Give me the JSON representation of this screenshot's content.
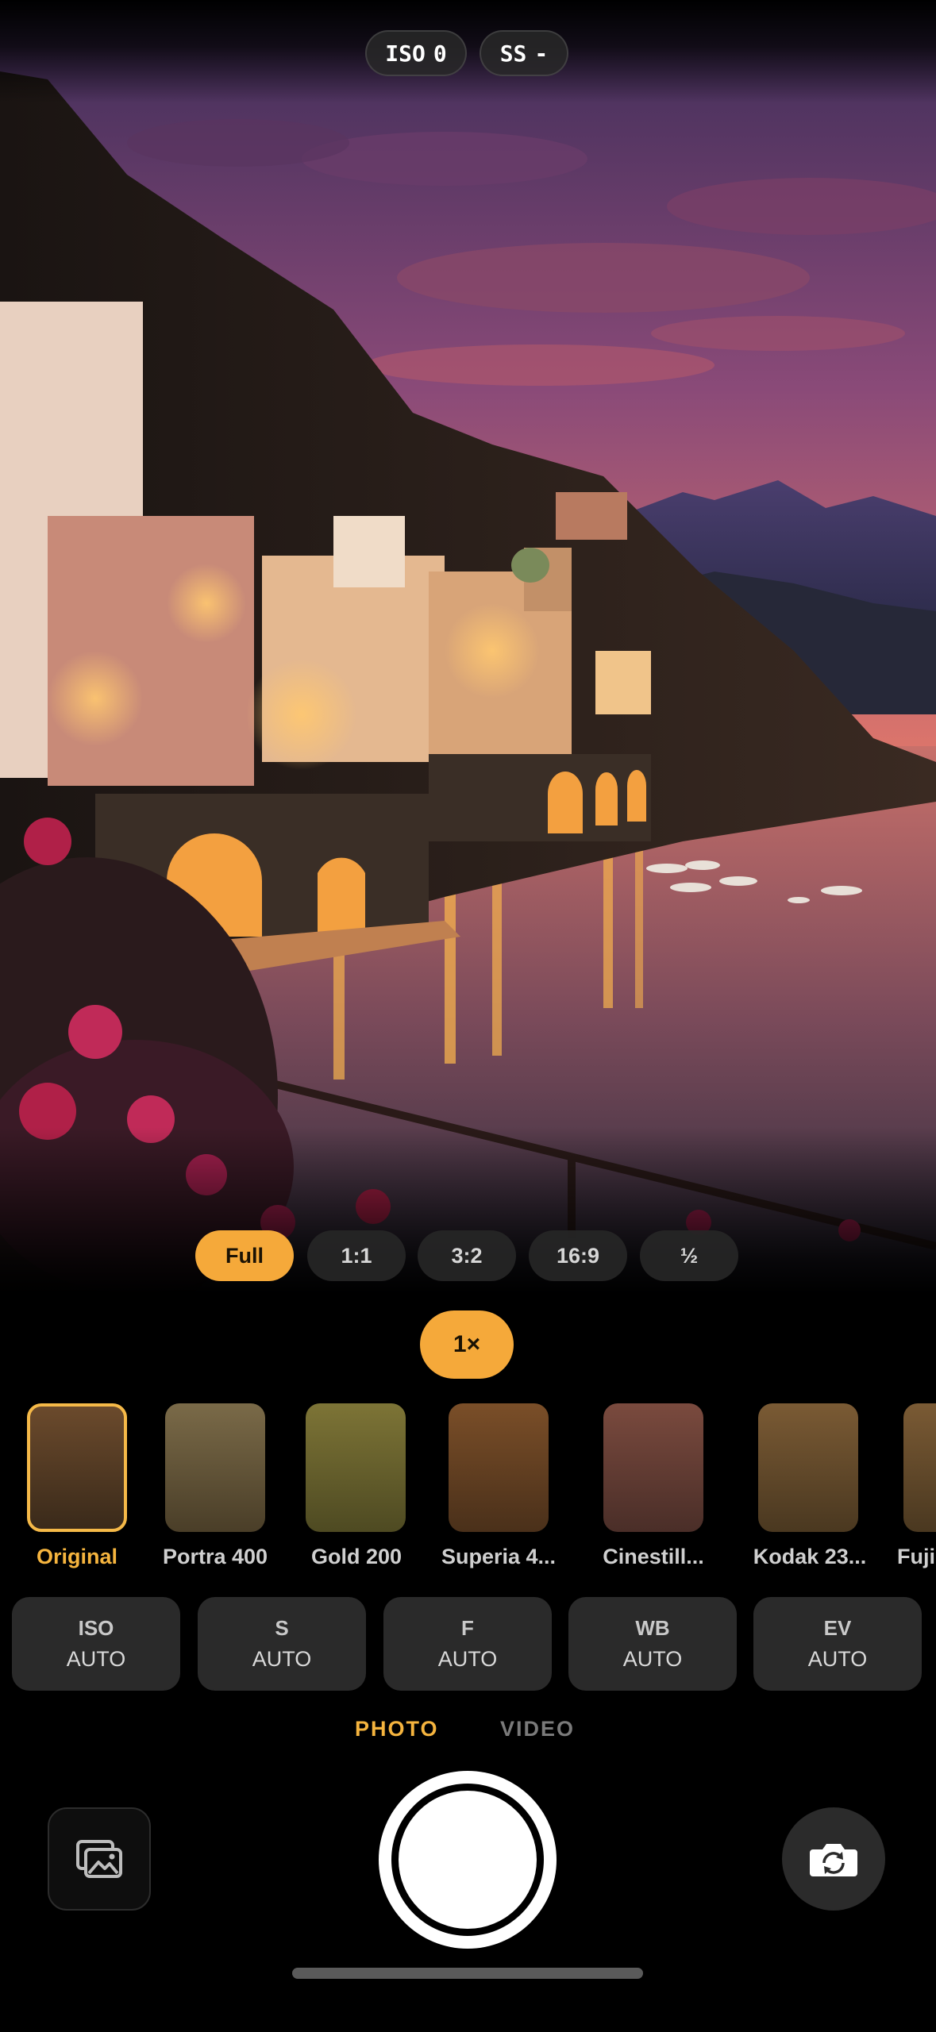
{
  "exposure_readout": {
    "iso_label": "ISO",
    "iso_value": "0",
    "ss_label": "SS",
    "ss_value": "-"
  },
  "aspect_ratios": {
    "options": [
      "Full",
      "1:1",
      "3:2",
      "16:9",
      "½"
    ],
    "selected": "Full"
  },
  "zoom": {
    "label": "1×"
  },
  "filters": {
    "items": [
      {
        "label": "Original",
        "color_top": "#6b4a2c",
        "color_bottom": "#3a2a1a"
      },
      {
        "label": "Portra 400",
        "color_top": "#7a6a48",
        "color_bottom": "#4a3e28"
      },
      {
        "label": "Gold 200",
        "color_top": "#7d7436",
        "color_bottom": "#4e4a22"
      },
      {
        "label": "Superia 4...",
        "color_top": "#7a4e28",
        "color_bottom": "#4a301a"
      },
      {
        "label": "Cinestill...",
        "color_top": "#7a4a3e",
        "color_bottom": "#4a2e28"
      },
      {
        "label": "Kodak 23...",
        "color_top": "#7a5a34",
        "color_bottom": "#4a3820"
      },
      {
        "label": "Fuji",
        "color_top": "#7a5a34",
        "color_bottom": "#4a3820"
      }
    ],
    "selected": "Original"
  },
  "params": [
    {
      "label": "ISO",
      "value": "AUTO"
    },
    {
      "label": "S",
      "value": "AUTO"
    },
    {
      "label": "F",
      "value": "AUTO"
    },
    {
      "label": "WB",
      "value": "AUTO"
    },
    {
      "label": "EV",
      "value": "AUTO"
    }
  ],
  "modes": {
    "photo": "PHOTO",
    "video": "VIDEO",
    "selected": "PHOTO"
  },
  "colors": {
    "accent": "#f5a93a",
    "chip_bg": "#2a2a2a"
  },
  "icons": {
    "gallery": "photo-gallery-icon",
    "flip": "camera-flip-icon"
  }
}
